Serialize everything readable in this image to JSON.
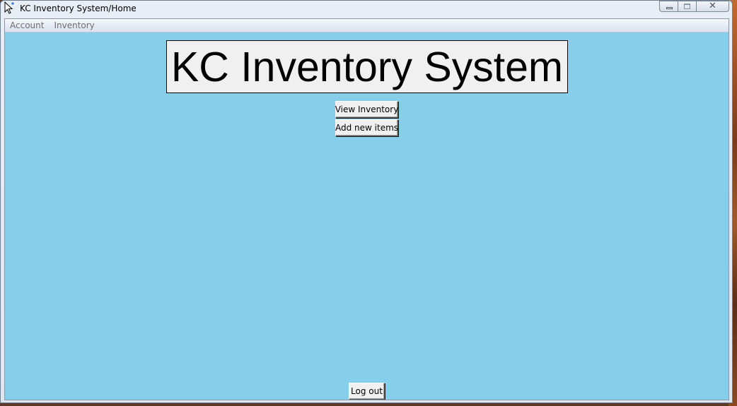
{
  "window": {
    "title": "KC Inventory System/Home",
    "app_icon": "pointer-cursor-icon",
    "controls": {
      "minimize_icon": "minimize-icon",
      "maximize_icon": "maximize-icon",
      "close_icon": "close-icon",
      "close_glyph": "✕"
    }
  },
  "menubar": {
    "items": [
      {
        "label": "Account"
      },
      {
        "label": "Inventory"
      }
    ]
  },
  "main": {
    "heading": "KC Inventory System",
    "buttons": {
      "view_inventory": "View Inventory",
      "add_new_items": "Add new items",
      "log_out": "Log out"
    }
  },
  "colors": {
    "background": "#87ceeb",
    "heading_bg": "#f0f0f0",
    "button_bg": "#f0f0f0"
  }
}
